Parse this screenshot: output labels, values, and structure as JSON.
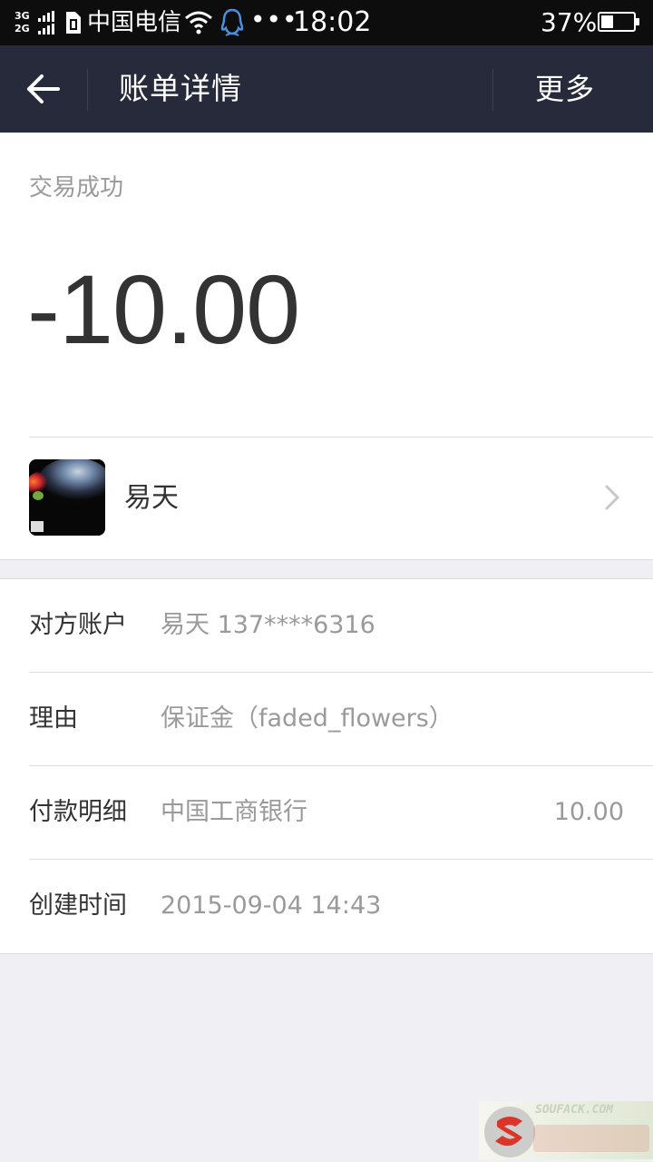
{
  "status_bar": {
    "network_type_1": "3G",
    "network_type_2": "2G",
    "carrier": "中国电信",
    "more_dots": "•••",
    "time": "18:02",
    "battery_percent": "37%",
    "battery_level": 0.37
  },
  "header": {
    "title": "账单详情",
    "more_label": "更多"
  },
  "summary": {
    "status": "交易成功",
    "amount": "-10.00",
    "payee_name": "易天"
  },
  "details": [
    {
      "label": "对方账户",
      "value": "易天 137****6316",
      "amount": ""
    },
    {
      "label": "理由",
      "value": "保证金（faded_flowers）",
      "amount": ""
    },
    {
      "label": "付款明细",
      "value": "中国工商银行",
      "amount": "10.00"
    },
    {
      "label": "创建时间",
      "value": "2015-09-04 14:43",
      "amount": ""
    }
  ],
  "watermark": {
    "url": "SOUFACK.COM"
  },
  "colors": {
    "header_bg": "#262a3b",
    "page_bg": "#efeff4",
    "muted_text": "#9a9a9a"
  }
}
